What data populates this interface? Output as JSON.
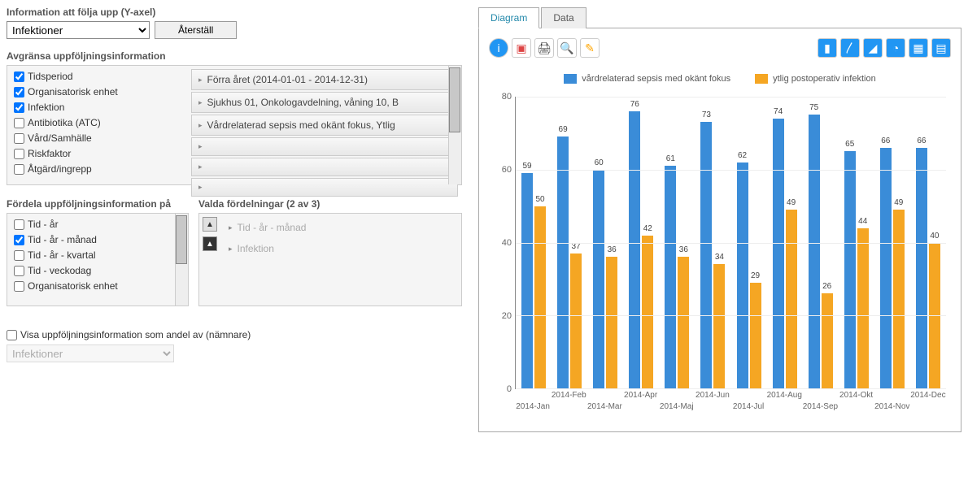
{
  "colors": {
    "blue": "#3a8cd8",
    "orange": "#f5a623"
  },
  "left": {
    "yaxis_title": "Information att följa upp (Y-axel)",
    "yaxis_value": "Infektioner",
    "reset_label": "Återställ",
    "filter_title": "Avgränsa uppföljningsinformation",
    "filter_checks": [
      {
        "label": "Tidsperiod",
        "checked": true
      },
      {
        "label": "Organisatorisk enhet",
        "checked": true
      },
      {
        "label": "Infektion",
        "checked": true
      },
      {
        "label": "Antibiotika (ATC)",
        "checked": false
      },
      {
        "label": "Vård/Samhälle",
        "checked": false
      },
      {
        "label": "Riskfaktor",
        "checked": false
      },
      {
        "label": "Åtgärd/ingrepp",
        "checked": false
      }
    ],
    "filter_values": [
      "Förra året (2014-01-01 - 2014-12-31)",
      "Sjukhus 01, Onkologavdelning, våning 10, B",
      "Vårdrelaterad sepsis med okänt fokus, Ytlig"
    ],
    "dist_title": "Fördela uppföljningsinformation på",
    "dist_checks": [
      {
        "label": "Tid - år",
        "checked": false
      },
      {
        "label": "Tid - år - månad",
        "checked": true
      },
      {
        "label": "Tid - år - kvartal",
        "checked": false
      },
      {
        "label": "Tid - veckodag",
        "checked": false
      },
      {
        "label": "Organisatorisk enhet",
        "checked": false
      }
    ],
    "selected_title": "Valda fördelningar (2 av 3)",
    "selected_items": [
      "Tid - år - månad",
      "Infektion"
    ],
    "share_label": "Visa uppföljningsinformation som andel av (nämnare)",
    "share_value": "Infektioner"
  },
  "tabs": {
    "diagram": "Diagram",
    "data": "Data"
  },
  "chart_data": {
    "type": "bar",
    "ylim": [
      0,
      80
    ],
    "yticks": [
      0,
      20,
      40,
      60,
      80
    ],
    "categories": [
      "2014-Jan",
      "2014-Feb",
      "2014-Mar",
      "2014-Apr",
      "2014-Maj",
      "2014-Jun",
      "2014-Jul",
      "2014-Aug",
      "2014-Sep",
      "2014-Okt",
      "2014-Nov",
      "2014-Dec"
    ],
    "series": [
      {
        "name": "vårdrelaterad sepsis med okänt fokus",
        "color": "#3a8cd8",
        "values": [
          59,
          69,
          60,
          76,
          61,
          73,
          62,
          74,
          75,
          65,
          66,
          66
        ]
      },
      {
        "name": "ytlig postoperativ infektion",
        "color": "#f5a623",
        "values": [
          50,
          37,
          36,
          42,
          36,
          34,
          29,
          49,
          26,
          44,
          49,
          40
        ]
      }
    ]
  }
}
